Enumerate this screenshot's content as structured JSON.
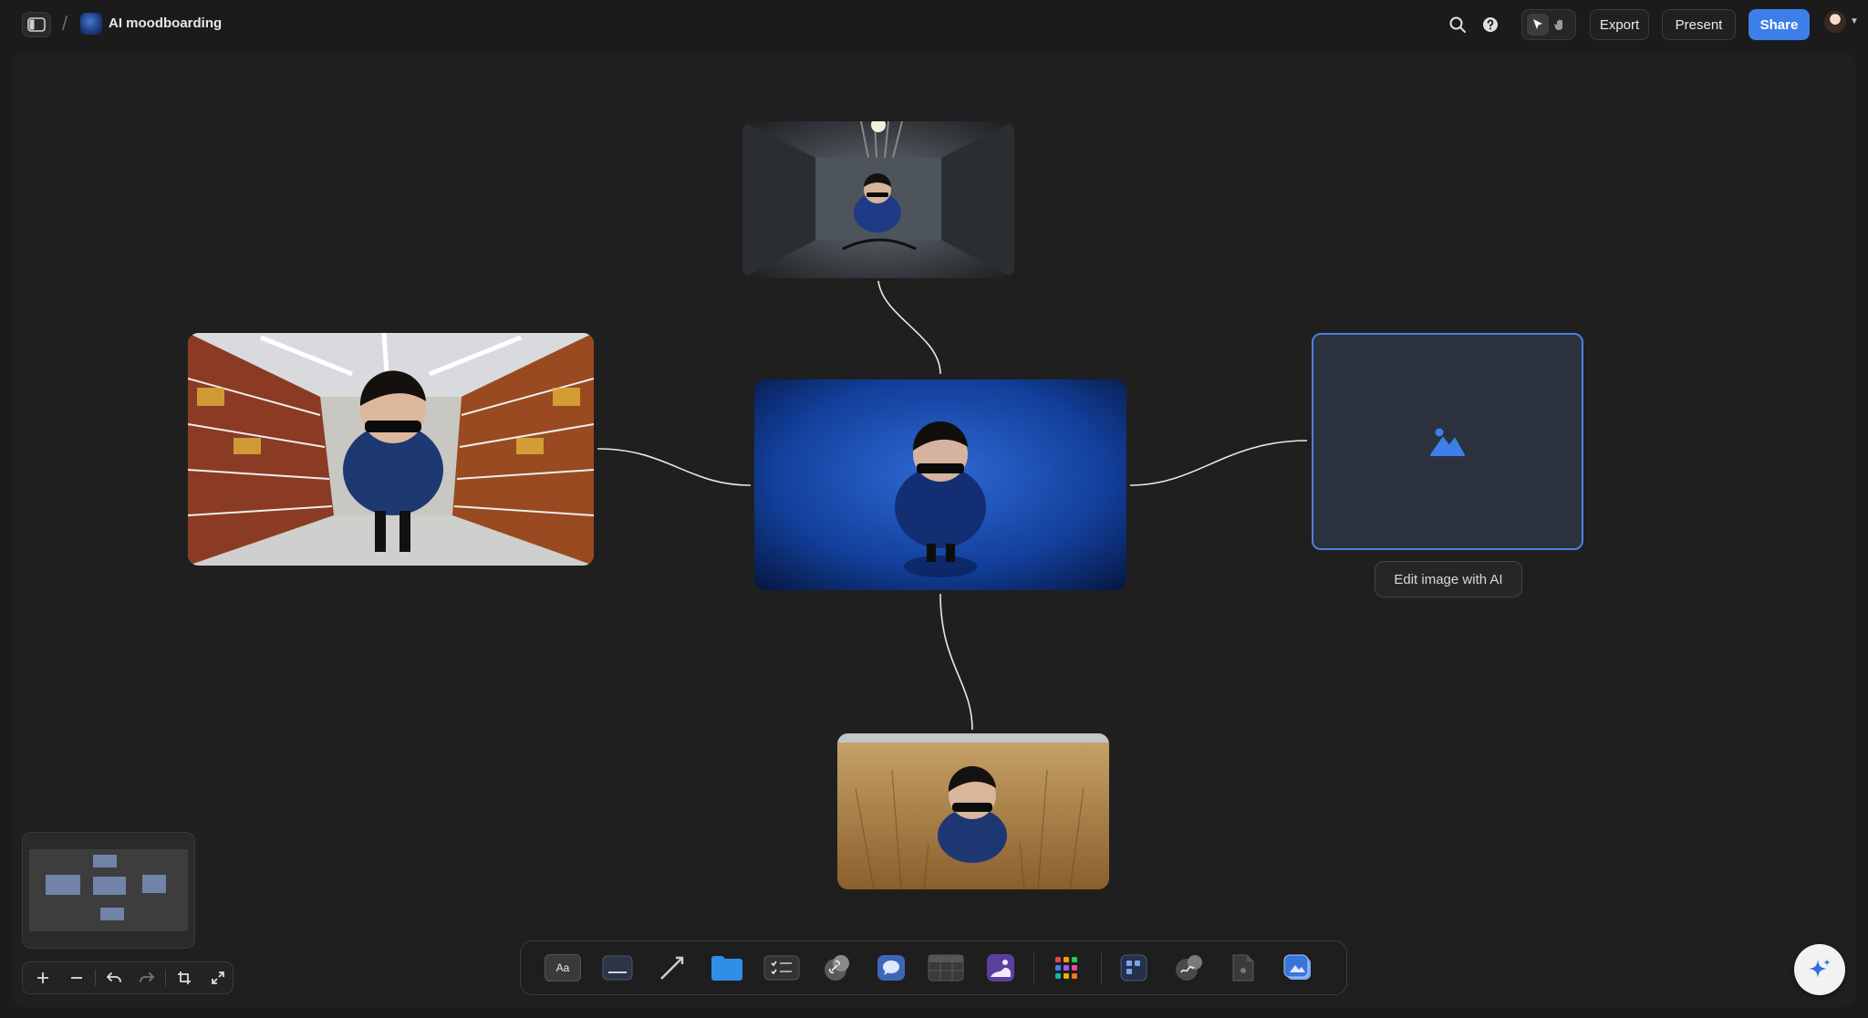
{
  "header": {
    "breadcrumb_separator": "/",
    "board_title": "AI moodboarding",
    "export_label": "Export",
    "present_label": "Present",
    "share_label": "Share"
  },
  "canvas": {
    "images": [
      {
        "name": "jail-cell-photo"
      },
      {
        "name": "supermarket-aisle-photo"
      },
      {
        "name": "blue-studio-photo"
      },
      {
        "name": "wheat-field-photo"
      }
    ],
    "placeholder": {
      "icon": "image-icon"
    },
    "edit_ai_label": "Edit image with AI"
  },
  "toolbar": {
    "text_tool_label": "Aa",
    "tools": [
      "text-tool",
      "note-tool",
      "line-tool",
      "folder-tool",
      "todo-tool",
      "link-tool",
      "comment-tool",
      "table-tool",
      "image-tool",
      "apps-tool",
      "board-tool",
      "sketch-tool",
      "document-tool",
      "ai-image-tool"
    ]
  },
  "colors": {
    "accent": "#3d7fe8",
    "canvas": "#1f1f1f",
    "background": "#1b1b1b"
  }
}
